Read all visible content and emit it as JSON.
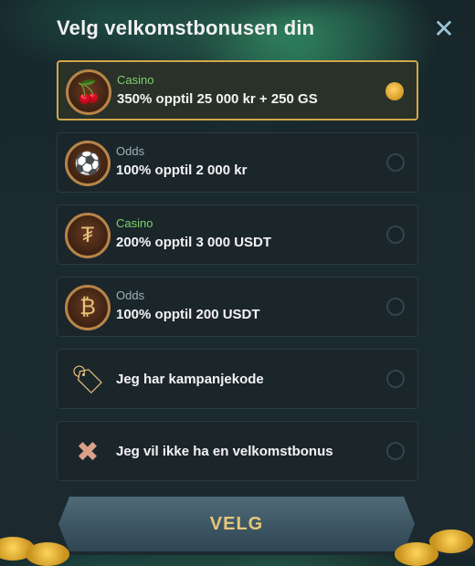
{
  "header": {
    "title": "Velg velkomstbonusen din",
    "close_icon": "close-icon"
  },
  "options": [
    {
      "category": "Casino",
      "label": "350% opptil 25 000 kr + 250 GS",
      "icon": "cherry-icon",
      "selected": true
    },
    {
      "category": "Odds",
      "label": "100% opptil 2 000 kr",
      "icon": "football-icon",
      "selected": false
    },
    {
      "category": "Casino",
      "label": "200% opptil 3 000 USDT",
      "icon": "tether-icon",
      "selected": false
    },
    {
      "category": "Odds",
      "label": "100% opptil 200 USDT",
      "icon": "bitcoin-icon",
      "selected": false
    },
    {
      "category": "",
      "label": "Jeg har kampanjekode",
      "icon": "promo-tag-icon",
      "selected": false
    },
    {
      "category": "",
      "label": "Jeg vil ikke ha en velkomstbonus",
      "icon": "no-bonus-icon",
      "selected": false
    }
  ],
  "footer": {
    "button_label": "VELG"
  },
  "colors": {
    "accent_gold": "#d2a64b",
    "casino_green": "#7fd16c"
  }
}
